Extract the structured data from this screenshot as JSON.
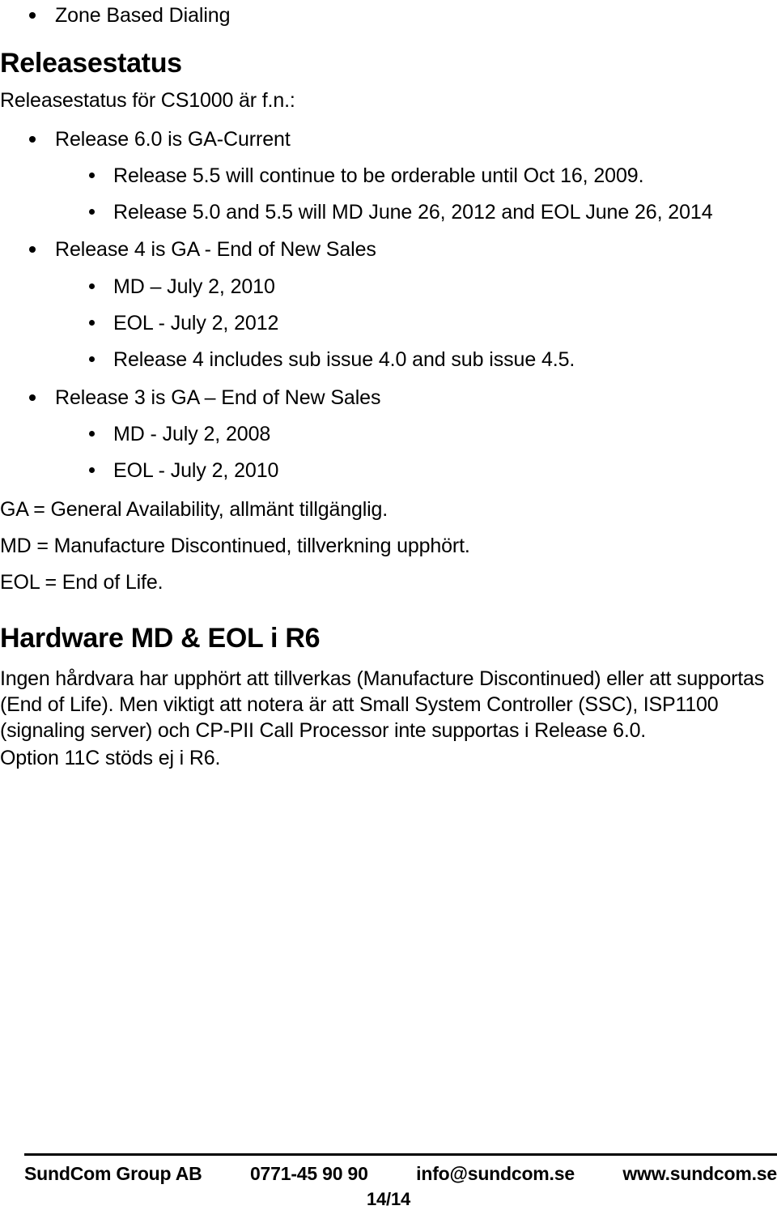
{
  "document": {
    "top_bullet": {
      "label": "Zone Based Dialing",
      "level": 1
    },
    "section_releasestatus": {
      "heading": "Releasestatus",
      "intro": "Releasestatus för CS1000 är f.n.:",
      "bullets": [
        {
          "label": "Release 6.0 is GA-Current",
          "level": 1
        },
        {
          "label": "Release 5.5 will continue to be orderable until Oct 16, 2009.",
          "level": 2
        },
        {
          "label": "Release 5.0 and 5.5 will MD June 26, 2012 and EOL June 26, 2014",
          "level": 2
        },
        {
          "label": "Release 4 is GA - End of New Sales",
          "level": 1
        },
        {
          "label": "MD – July 2, 2010",
          "level": 2
        },
        {
          "label": "EOL - July 2, 2012",
          "level": 2
        },
        {
          "label": "Release 4 includes sub issue 4.0 and sub issue 4.5.",
          "level": 2
        },
        {
          "label": "Release 3 is GA – End of New Sales",
          "level": 1
        },
        {
          "label": "MD - July 2, 2008",
          "level": 2
        },
        {
          "label": "EOL - July 2, 2010",
          "level": 2
        }
      ],
      "definitions": [
        "GA = General Availability, allmänt tillgänglig.",
        "MD = Manufacture Discontinued, tillverkning upphört.",
        "EOL = End of Life."
      ]
    },
    "section_hardware": {
      "heading": "Hardware MD & EOL i R6",
      "paragraph": "Ingen hårdvara har upphört att tillverkas (Manufacture Discontinued) eller att supportas (End of Life). Men viktigt att notera är att Small System Controller (SSC), ISP1100 (signaling server) och CP-PII Call Processor inte supportas i Release 6.0.",
      "closing": "Option 11C stöds ej i R6."
    }
  },
  "footer": {
    "company": "SundCom Group AB",
    "phone": "0771-45 90 90",
    "email": "info@sundcom.se",
    "website": "www.sundcom.se",
    "page_number": "14/14"
  }
}
